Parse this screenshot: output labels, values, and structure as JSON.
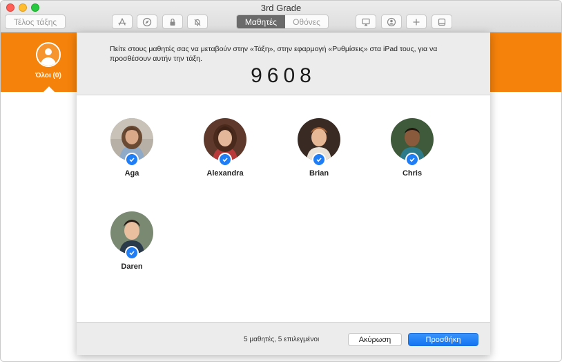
{
  "window": {
    "title": "3rd Grade"
  },
  "toolbar": {
    "end_class_label": "Τέλος τάξης",
    "icons": [
      "apps-icon",
      "compass-icon",
      "lock-icon",
      "bell-off-icon",
      "airplay-icon",
      "person-add-icon",
      "plus-icon",
      "tray-icon"
    ],
    "segments": [
      "Μαθητές",
      "Οθόνες"
    ],
    "selected_segment": "Μαθητές"
  },
  "group": {
    "label": "Όλοι (0)"
  },
  "sheet": {
    "instruction": "Πείτε στους μαθητές σας να μεταβούν στην «Τάξη», στην εφαρμογή «Ρυθμίσεις» στα iPad τους, για να προσθέσουν αυτήν την τάξη.",
    "code": "9608",
    "students": [
      {
        "name": "Aga",
        "selected": true
      },
      {
        "name": "Alexandra",
        "selected": true
      },
      {
        "name": "Brian",
        "selected": true
      },
      {
        "name": "Chris",
        "selected": true
      },
      {
        "name": "Daren",
        "selected": true
      }
    ],
    "summary": "5 μαθητές, 5 επιλεγμένοι",
    "cancel_label": "Ακύρωση",
    "add_label": "Προσθήκη"
  },
  "colors": {
    "accent": "#f5820a",
    "primary_button": "#1f7df6",
    "check": "#1f7df6"
  }
}
